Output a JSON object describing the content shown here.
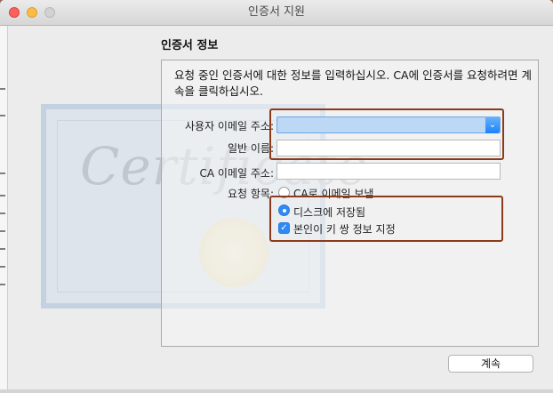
{
  "window": {
    "title": "인증서 지원"
  },
  "section": {
    "title": "인증서 정보"
  },
  "description": "요청 중인 인증서에 대한 정보를 입력하십시오. CA에 인증서를 요청하려면 계속을 클릭하십시오.",
  "form": {
    "email_label": "사용자 이메일 주소:",
    "name_label": "일반 이름:",
    "ca_email_label": "CA 이메일 주소:",
    "request_label": "요청 항목:"
  },
  "options": {
    "email_to_ca": "CA로 이메일 보냄",
    "save_to_disk": "디스크에 저장됨",
    "specify_key_pair": "본인이 키 쌍 정보 지정"
  },
  "buttons": {
    "cancel": "계속"
  },
  "background": {
    "certificate_text": "Certificate"
  },
  "colors": {
    "accent": "#2f8af5",
    "highlight": "#8b3a1b"
  }
}
